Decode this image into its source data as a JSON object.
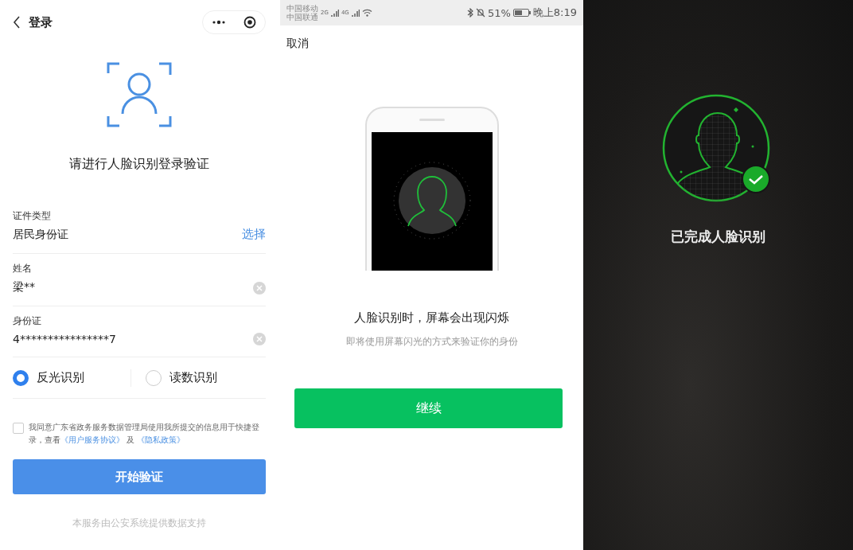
{
  "login": {
    "title": "登录",
    "prompt": "请进行人脸识别登录验证",
    "fields": [
      {
        "kind": "select",
        "label": "证件类型",
        "value": "居民身份证",
        "action": "选择"
      },
      {
        "kind": "clearable",
        "label": "姓名",
        "value": "梁**"
      },
      {
        "kind": "clearable",
        "label": "身份证",
        "value": "4****************7"
      }
    ],
    "modes": [
      {
        "label": "反光识别",
        "selected": true
      },
      {
        "label": "读数识别",
        "selected": false
      }
    ],
    "agreement": {
      "checked": false,
      "text": "我同意广东省政务服务数据管理局使用我所提交的信息用于快捷登录，查看",
      "links": [
        "《用户服务协议》",
        "《隐私政策》"
      ],
      "joiner": "及"
    },
    "submit": "开始验证",
    "footer": "本服务由公安系统提供数据支持"
  },
  "flash_screen": {
    "status_bar": {
      "carriers": [
        "中国移动",
        "中国联通"
      ],
      "networks": [
        "2G",
        "4G"
      ],
      "battery": "51%",
      "time": "晚上8:19"
    },
    "cancel": "取消",
    "title": "人脸识别时，屏幕会出现闪烁",
    "subtitle": "即将使用屏幕闪光的方式来验证你的身份",
    "continue": "继续"
  },
  "done_screen": {
    "message": "已完成人脸识别"
  }
}
